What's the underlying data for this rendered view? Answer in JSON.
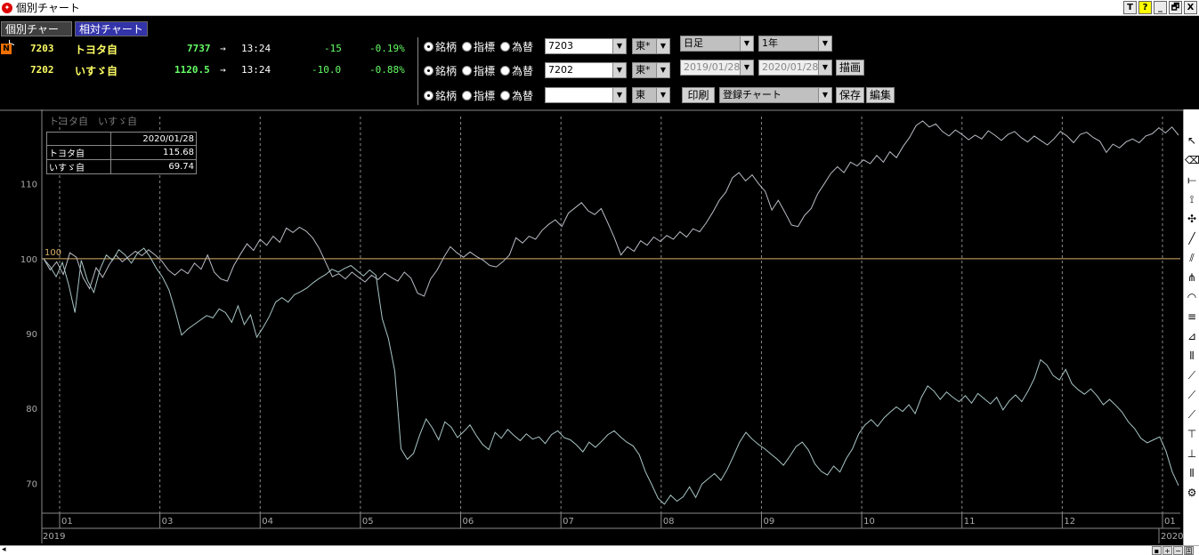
{
  "window": {
    "title": "個別チャート",
    "controls": {
      "t": "T",
      "help": "?",
      "min": "_",
      "restore": "🗗",
      "close": "X"
    }
  },
  "tabs": [
    {
      "label": "個別チャート"
    },
    {
      "label": "相対チャート"
    }
  ],
  "badge": "N",
  "quotes": [
    {
      "code": "7203",
      "name": "トヨタ自",
      "price": "7737",
      "arrow": "→",
      "time": "13:24",
      "change": "-15",
      "change_pct": "-0.19%"
    },
    {
      "code": "7202",
      "name": "いすゞ自",
      "price": "1120.5",
      "arrow": "→",
      "time": "13:24",
      "change": "-10.0",
      "change_pct": "-0.88%"
    }
  ],
  "selectors": [
    {
      "options": [
        "銘柄",
        "指標",
        "為替"
      ],
      "selected": 0,
      "symbol": "7203",
      "market": "東*"
    },
    {
      "options": [
        "銘柄",
        "指標",
        "為替"
      ],
      "selected": 0,
      "symbol": "7202",
      "market": "東*"
    },
    {
      "options": [
        "銘柄",
        "指標",
        "為替"
      ],
      "selected": 0,
      "symbol": "",
      "market": "東"
    }
  ],
  "controls": {
    "period": "日足",
    "range": "1年",
    "date_from": "2019/01/28",
    "date_to": "2020/01/28",
    "draw_button": "描画",
    "print_button": "印刷",
    "registered_chart": "登録チャート",
    "save_button": "保存",
    "edit_button": "編集"
  },
  "legend": {
    "header": "トヨタ自　いすゞ自",
    "date": "2020/01/28",
    "rows": [
      {
        "name": "トヨタ自",
        "value": "115.68"
      },
      {
        "name": "いすゞ自",
        "value": "69.74"
      }
    ]
  },
  "statusbar": {
    "left": "◂",
    "buttons": [
      "▪",
      "+",
      "−",
      "固"
    ]
  },
  "tools": [
    "arrow-cursor-icon",
    "eraser-icon",
    "horizontal-line-icon",
    "vertical-line-icon",
    "cross-line-icon",
    "trend-line-icon",
    "channel-icon",
    "fibonacci-fan-icon",
    "fibonacci-arc-icon",
    "fibonacci-retracement-icon",
    "gann-icon",
    "bars-icon",
    "line-tool-icon",
    "regression-icon",
    "zigzag-icon",
    "text-top-icon",
    "text-bottom-icon",
    "bars-2-icon",
    "settings-icon"
  ],
  "chart_data": {
    "type": "line",
    "baseline": 100,
    "baseline_label": "100",
    "ylim": [
      66,
      119
    ],
    "yticks": [
      70,
      80,
      90,
      100,
      110
    ],
    "xticks": [
      "01",
      "03",
      "04",
      "05",
      "06",
      "07",
      "08",
      "09",
      "10",
      "11",
      "12",
      "01"
    ],
    "year_labels": [
      "2019",
      "2020"
    ],
    "colors": {
      "toyota": "#b8bcc4",
      "isuzu": "#a8c4c4",
      "baseline": "#d9b06a",
      "grid": "#888888"
    },
    "series": [
      {
        "name": "トヨタ自",
        "values": [
          100,
          98.5,
          99.6,
          97.9,
          100.8,
          100.2,
          97.5,
          96.0,
          98.8,
          97.5,
          99.2,
          100.5,
          99.6,
          100.3,
          101.0,
          100.4,
          101.2,
          100.5,
          99.7,
          98.5,
          97.8,
          98.6,
          98.0,
          99.4,
          98.6,
          100.5,
          98.2,
          97.3,
          97.0,
          99.1,
          100.6,
          102.0,
          101.1,
          102.6,
          101.8,
          103.0,
          102.2,
          104.1,
          103.5,
          104.2,
          103.7,
          102.8,
          101.4,
          99.5,
          97.6,
          98.0,
          97.3,
          98.2,
          97.5,
          96.9,
          97.8,
          97.2,
          98.1,
          97.5,
          97.0,
          98.2,
          97.4,
          95.4,
          95.0,
          97.3,
          98.5,
          100.2,
          101.6,
          100.8,
          100.2,
          100.9,
          100.3,
          99.8,
          99.1,
          98.9,
          99.6,
          100.5,
          102.8,
          102.1,
          103.0,
          102.6,
          103.8,
          104.6,
          105.2,
          104.3,
          106.1,
          106.8,
          107.5,
          106.4,
          105.9,
          106.7,
          104.8,
          102.8,
          100.5,
          101.6,
          101.0,
          102.4,
          101.8,
          102.9,
          102.3,
          103.1,
          102.6,
          103.6,
          102.9,
          104.0,
          103.6,
          104.8,
          106.2,
          107.8,
          108.9,
          110.8,
          111.5,
          110.4,
          111.2,
          110.0,
          109.0,
          106.5,
          107.8,
          106.2,
          104.5,
          104.3,
          105.8,
          106.7,
          108.7,
          110.0,
          111.4,
          112.3,
          111.5,
          112.9,
          112.4,
          113.2,
          112.7,
          113.8,
          112.9,
          114.3,
          113.5,
          115.0,
          116.2,
          117.8,
          118.4,
          117.6,
          118.0,
          117.0,
          116.4,
          117.2,
          116.6,
          115.9,
          116.5,
          116.0,
          117.1,
          116.5,
          115.8,
          116.6,
          117.0,
          116.2,
          115.6,
          116.4,
          115.8,
          115.2,
          116.0,
          117.0,
          116.4,
          115.5,
          116.6,
          116.9,
          116.2,
          115.7,
          114.2,
          115.3,
          114.8,
          115.6,
          116.0,
          115.5,
          116.4,
          116.7,
          117.5,
          116.8,
          117.6,
          116.5
        ]
      },
      {
        "name": "いすゞ自",
        "values": [
          100,
          99.0,
          97.6,
          99.5,
          96.5,
          92.8,
          99.8,
          97.1,
          95.5,
          98.6,
          100.5,
          99.8,
          101.2,
          100.5,
          99.4,
          100.8,
          101.4,
          100.2,
          98.7,
          97.5,
          95.8,
          93.0,
          89.8,
          90.6,
          91.2,
          91.8,
          92.4,
          92.1,
          93.3,
          92.8,
          91.5,
          93.7,
          91.2,
          92.5,
          89.5,
          90.8,
          92.3,
          94.2,
          94.8,
          94.2,
          95.2,
          95.6,
          96.1,
          96.8,
          97.4,
          97.9,
          98.6,
          98.2,
          98.7,
          99.1,
          98.4,
          97.7,
          98.5,
          97.8,
          92.0,
          89.3,
          85.0,
          74.6,
          73.2,
          74.0,
          76.5,
          78.6,
          77.4,
          75.8,
          78.2,
          77.5,
          76.1,
          76.9,
          77.8,
          76.4,
          75.2,
          74.5,
          76.8,
          76.0,
          77.2,
          76.4,
          75.7,
          76.6,
          75.9,
          76.2,
          75.3,
          76.5,
          77.0,
          76.1,
          75.8,
          75.1,
          74.2,
          75.5,
          74.8,
          75.6,
          76.5,
          77.0,
          76.2,
          75.5,
          75.0,
          73.8,
          71.5,
          69.8,
          68.0,
          67.2,
          68.4,
          67.6,
          68.2,
          69.5,
          68.1,
          69.9,
          70.6,
          71.3,
          70.4,
          71.8,
          73.6,
          75.5,
          76.8,
          75.9,
          75.2,
          74.6,
          73.9,
          73.2,
          72.4,
          73.6,
          74.9,
          75.5,
          74.4,
          72.6,
          71.6,
          71.1,
          72.3,
          71.5,
          73.3,
          74.6,
          76.6,
          77.8,
          78.5,
          77.6,
          78.7,
          79.5,
          80.2,
          79.6,
          80.5,
          79.3,
          81.5,
          83.0,
          82.3,
          81.2,
          82.2,
          81.5,
          80.9,
          81.7,
          80.7,
          82.0,
          81.3,
          80.6,
          81.5,
          79.8,
          81.0,
          81.8,
          80.9,
          82.3,
          84.0,
          86.5,
          85.8,
          84.4,
          83.8,
          85.2,
          83.3,
          82.5,
          81.9,
          82.6,
          81.7,
          80.5,
          81.2,
          80.4,
          79.5,
          78.2,
          77.3,
          76.0,
          75.4,
          75.8,
          76.2,
          74.3,
          71.5,
          69.7
        ]
      }
    ]
  }
}
